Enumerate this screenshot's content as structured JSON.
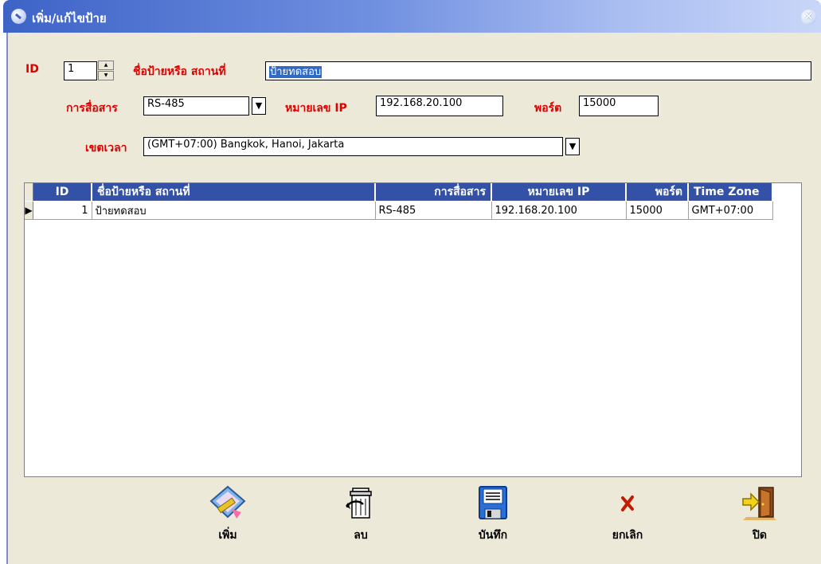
{
  "window": {
    "title": "เพิ่ม/แก้ไขป้าย",
    "close_glyph": "✕"
  },
  "form": {
    "id_label": "ID",
    "id_value": "1",
    "name_label": "ชื่อป้ายหรือ สถานที่",
    "name_value": "ป้ายทดสอบ",
    "comm_label": "การสื่อสาร",
    "comm_value": "RS-485",
    "ip_label": "หมายเลข IP",
    "ip_value": "192.168.20.100",
    "port_label": "พอร์ต",
    "port_value": "15000",
    "tz_label": "เขตเวลา",
    "tz_value": "(GMT+07:00) Bangkok, Hanoi, Jakarta"
  },
  "grid": {
    "columns": [
      "ID",
      "ชื่อป้ายหรือ สถานที่",
      "การสื่อสาร",
      "หมายเลข IP",
      "พอร์ต",
      "Time Zone"
    ],
    "rows": [
      {
        "id": "1",
        "name": "ป้ายทดสอบ",
        "comm": "RS-485",
        "ip": "192.168.20.100",
        "port": "15000",
        "tz": "GMT+07:00"
      }
    ]
  },
  "toolbar": {
    "add_label": "เพิ่ม",
    "delete_label": "ลบ",
    "save_label": "บันทึก",
    "cancel_label": "ยกเลิก",
    "close_label": "ปิด"
  },
  "colors": {
    "label_red": "#e00000",
    "header_blue": "#3451a8",
    "titlebar_blue": "#3d63c7",
    "panel": "#ece9d8"
  }
}
